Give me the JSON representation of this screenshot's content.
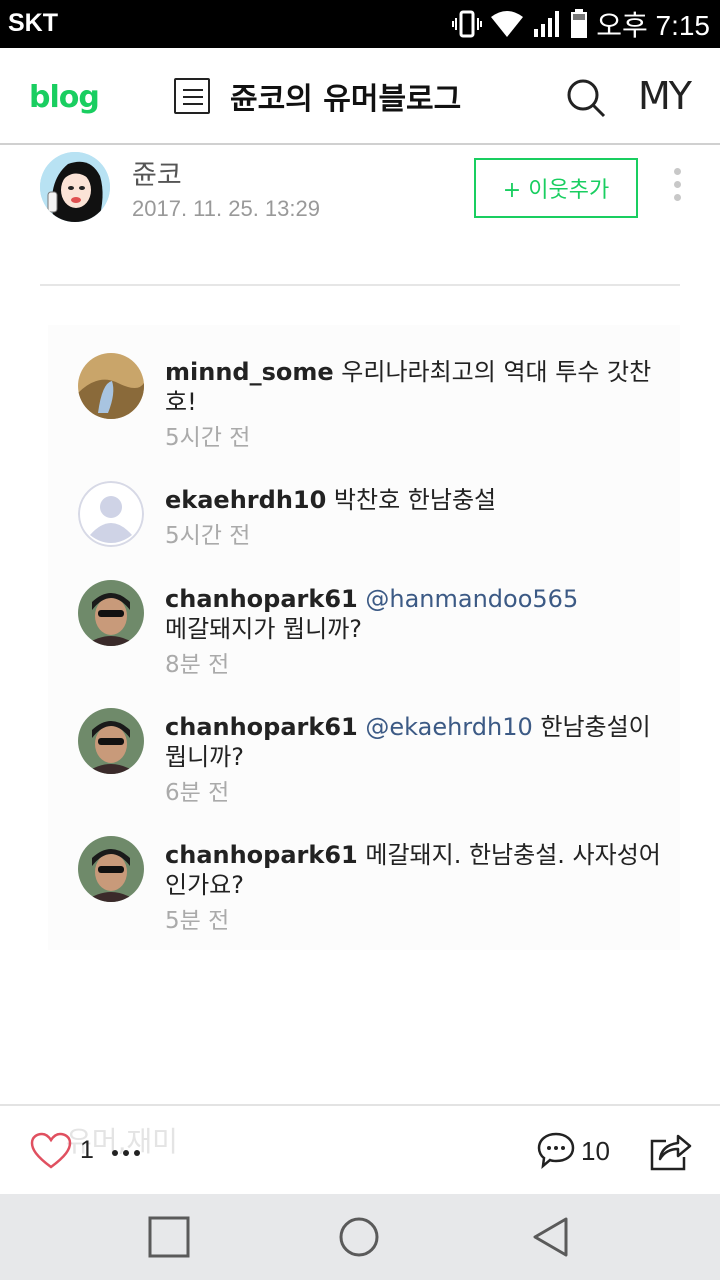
{
  "status_bar": {
    "carrier": "SKT",
    "time": "오후 7:15",
    "icons": [
      "vibrate-icon",
      "wifi-icon",
      "signal-icon",
      "battery-icon"
    ]
  },
  "header": {
    "logo": "blog",
    "blog_title": "쥰코의 유머블로그",
    "my_label": "MY",
    "icons": [
      "list-icon",
      "search-icon"
    ],
    "accent_color": "#19ce60"
  },
  "post": {
    "author": "쥰코",
    "date": "2017. 11. 25. 13:29",
    "add_neighbor": "+ 이웃추가"
  },
  "comments": [
    {
      "user": "minnd_some",
      "mention": "",
      "text": " 우리나라최고의 역대 투수 갓찬호!",
      "time": "5시간 전"
    },
    {
      "user": "ekaehrdh10",
      "mention": "",
      "text": " 박찬호 한남충설",
      "time": "5시간 전"
    },
    {
      "user": "chanhopark61",
      "mention": " @hanmandoo565",
      "text": " 메갈돼지가 뭡니까?",
      "time": "8분 전"
    },
    {
      "user": "chanhopark61",
      "mention": " @ekaehrdh10",
      "text": " 한남충설이 뭡니까?",
      "time": "6분 전"
    },
    {
      "user": "chanhopark61",
      "mention": "",
      "text": " 메갈돼지. 한남충설. 사자성어 인가요?",
      "time": "5분 전"
    }
  ],
  "actions": {
    "ghost_text": "유머,재미",
    "like_count": "1",
    "comment_count": "10"
  }
}
